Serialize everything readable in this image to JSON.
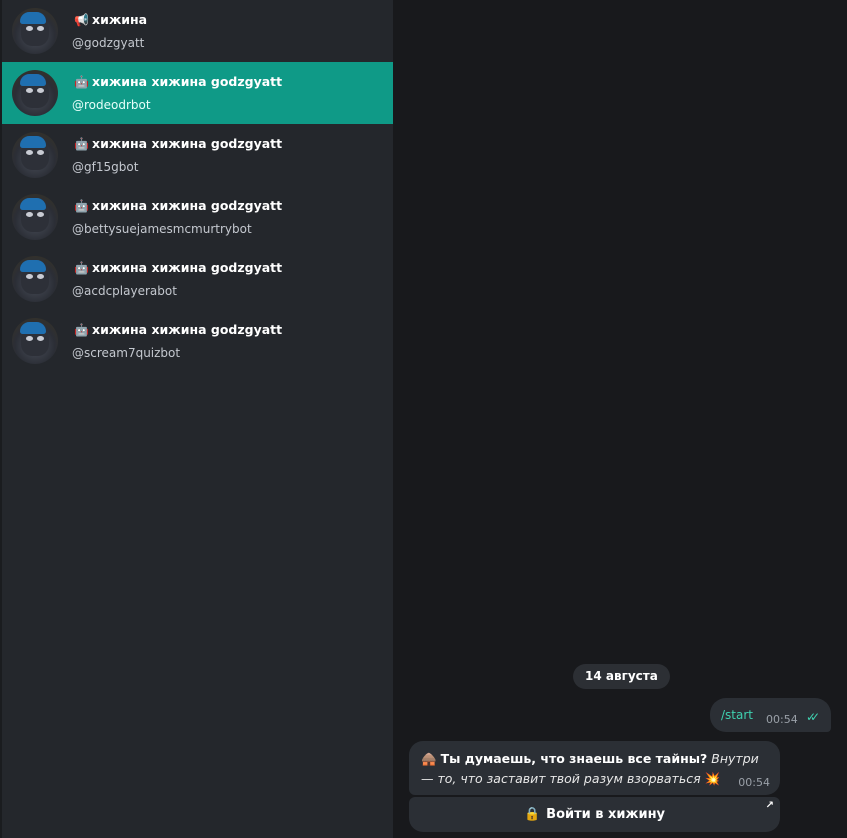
{
  "chats": [
    {
      "icon": "megaphone-icon",
      "glyph": "📢",
      "title": "хижина",
      "username": "@godzgyatt",
      "active": false
    },
    {
      "icon": "bot-icon",
      "glyph": "🤖",
      "title": "хижина хижина godzgyatt",
      "username": "@rodeodrbot",
      "active": true
    },
    {
      "icon": "bot-icon",
      "glyph": "🤖",
      "title": "хижина хижина godzgyatt",
      "username": "@gf15gbot",
      "active": false
    },
    {
      "icon": "bot-icon",
      "glyph": "🤖",
      "title": "хижина хижина godzgyatt",
      "username": "@bettysuejamesmcmurtrybot",
      "active": false
    },
    {
      "icon": "bot-icon",
      "glyph": "🤖",
      "title": "хижина хижина godzgyatt",
      "username": "@acdcplayerabot",
      "active": false
    },
    {
      "icon": "bot-icon",
      "glyph": "🤖",
      "title": "хижина хижина godzgyatt",
      "username": "@scream7quizbot",
      "active": false
    }
  ],
  "conversation": {
    "date": "14 августа",
    "outgoing": {
      "text": "/start",
      "time": "00:54",
      "status": "read"
    },
    "incoming": {
      "emoji": "🛖",
      "bold_text": "Ты думаешь, что знаешь все тайны?",
      "italic_text": "Внутри — то, что заставит твой разум взорваться",
      "end_emoji": "💥",
      "time": "00:54"
    },
    "button": {
      "emoji": "🔒",
      "label": "Войти в хижину",
      "arrow": "↗"
    }
  },
  "colors": {
    "sidebar_bg": "#24272c",
    "active_bg": "#0f9a87",
    "chat_bg": "#18191c",
    "bubble_bg": "#2b2f35",
    "accent": "#3fd1b0"
  }
}
